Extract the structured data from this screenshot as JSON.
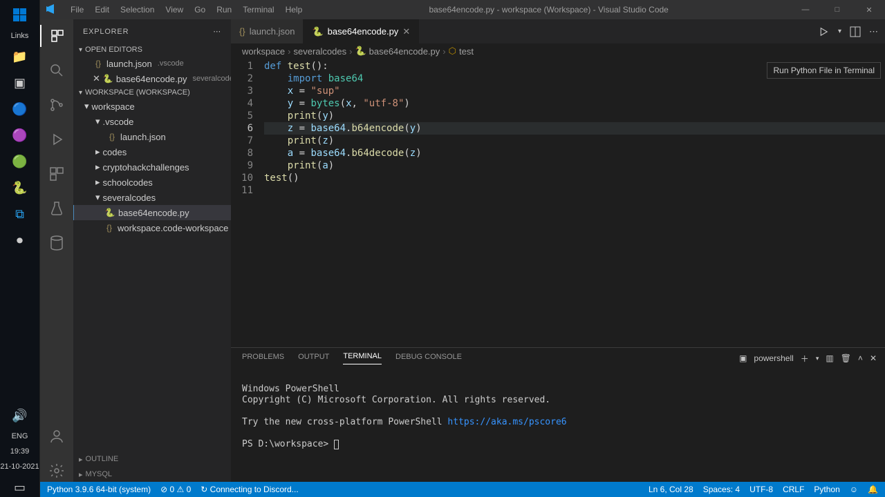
{
  "window": {
    "title": "base64encode.py - workspace (Workspace) - Visual Studio Code",
    "menu": [
      "File",
      "Edit",
      "Selection",
      "View",
      "Go",
      "Run",
      "Terminal",
      "Help"
    ]
  },
  "tooltip": {
    "run": "Run Python File in Terminal"
  },
  "sidebar": {
    "header": "EXPLORER",
    "sections": {
      "openEditors": "OPEN EDITORS",
      "workspace": "WORKSPACE (WORKSPACE)",
      "outline": "OUTLINE",
      "mysql": "MYSQL"
    },
    "openEditors": [
      {
        "name": "launch.json",
        "hint": ".vscode"
      },
      {
        "name": "base64encode.py",
        "hint": "severalcodes",
        "active": true
      }
    ],
    "tree": {
      "root": "workspace",
      "folders": [
        {
          "name": ".vscode",
          "open": true,
          "children": [
            {
              "name": "launch.json",
              "icon": "{}"
            }
          ]
        },
        {
          "name": "codes",
          "open": false
        },
        {
          "name": "cryptohackchallenges",
          "open": false
        },
        {
          "name": "schoolcodes",
          "open": false
        },
        {
          "name": "severalcodes",
          "open": true,
          "children": [
            {
              "name": "base64encode.py",
              "icon": "py",
              "active": true
            },
            {
              "name": "workspace.code-workspace",
              "icon": "{}"
            }
          ]
        }
      ]
    }
  },
  "tabs": [
    {
      "name": "launch.json",
      "icon": "{}",
      "active": false
    },
    {
      "name": "base64encode.py",
      "icon": "py",
      "active": true
    }
  ],
  "breadcrumb": [
    "workspace",
    "severalcodes",
    "base64encode.py",
    "test"
  ],
  "editor": {
    "currentLine": 6,
    "lines": [
      {
        "n": 1,
        "html": "<span class='kw'>def</span> <span class='fn'>test</span><span class='punc'>():</span>"
      },
      {
        "n": 2,
        "html": "    <span class='kw'>import</span> <span class='builtin'>base64</span>"
      },
      {
        "n": 3,
        "html": "    <span class='var'>x</span> <span class='punc'>=</span> <span class='str'>\"sup\"</span>"
      },
      {
        "n": 4,
        "html": "    <span class='var'>y</span> <span class='punc'>=</span> <span class='builtin'>bytes</span><span class='punc'>(</span><span class='var'>x</span><span class='punc'>,</span> <span class='str'>\"utf-8\"</span><span class='punc'>)</span>"
      },
      {
        "n": 5,
        "html": "    <span class='call'>print</span><span class='punc'>(</span><span class='var'>y</span><span class='punc'>)</span>"
      },
      {
        "n": 6,
        "html": "    <span class='var'>z</span> <span class='punc'>=</span> <span class='var'>base64</span><span class='punc'>.</span><span class='call'>b64encode</span><span class='punc'>(</span><span class='var'>y</span><span class='punc'>)</span>"
      },
      {
        "n": 7,
        "html": "    <span class='call'>print</span><span class='punc'>(</span><span class='var'>z</span><span class='punc'>)</span>"
      },
      {
        "n": 8,
        "html": "    <span class='var'>a</span> <span class='punc'>=</span> <span class='var'>base64</span><span class='punc'>.</span><span class='call'>b64decode</span><span class='punc'>(</span><span class='var'>z</span><span class='punc'>)</span>"
      },
      {
        "n": 9,
        "html": "    <span class='call'>print</span><span class='punc'>(</span><span class='var'>a</span><span class='punc'>)</span>"
      },
      {
        "n": 10,
        "html": "<span class='fn'>test</span><span class='punc'>()</span>"
      },
      {
        "n": 11,
        "html": ""
      }
    ]
  },
  "panel": {
    "tabs": [
      "PROBLEMS",
      "OUTPUT",
      "TERMINAL",
      "DEBUG CONSOLE"
    ],
    "active": "TERMINAL",
    "shell": "powershell",
    "terminal": {
      "line1": "Windows PowerShell",
      "line2": "Copyright (C) Microsoft Corporation. All rights reserved.",
      "line3": "Try the new cross-platform PowerShell ",
      "link": "https://aka.ms/pscore6",
      "prompt": "PS D:\\workspace> "
    }
  },
  "statusbar": {
    "python": "Python 3.9.6 64-bit (system)",
    "errors": "⊘ 0 ⚠ 0",
    "discord": "Connecting to Discord...",
    "sync": "↻",
    "cursor": "Ln 6, Col 28",
    "spaces": "Spaces: 4",
    "encoding": "UTF-8",
    "eol": "CRLF",
    "lang": "Python",
    "feedback": "☺",
    "bell": "🔔"
  },
  "taskbar": {
    "links": "Links",
    "lang": "ENG",
    "time": "19:39",
    "date": "21-10-2021"
  }
}
